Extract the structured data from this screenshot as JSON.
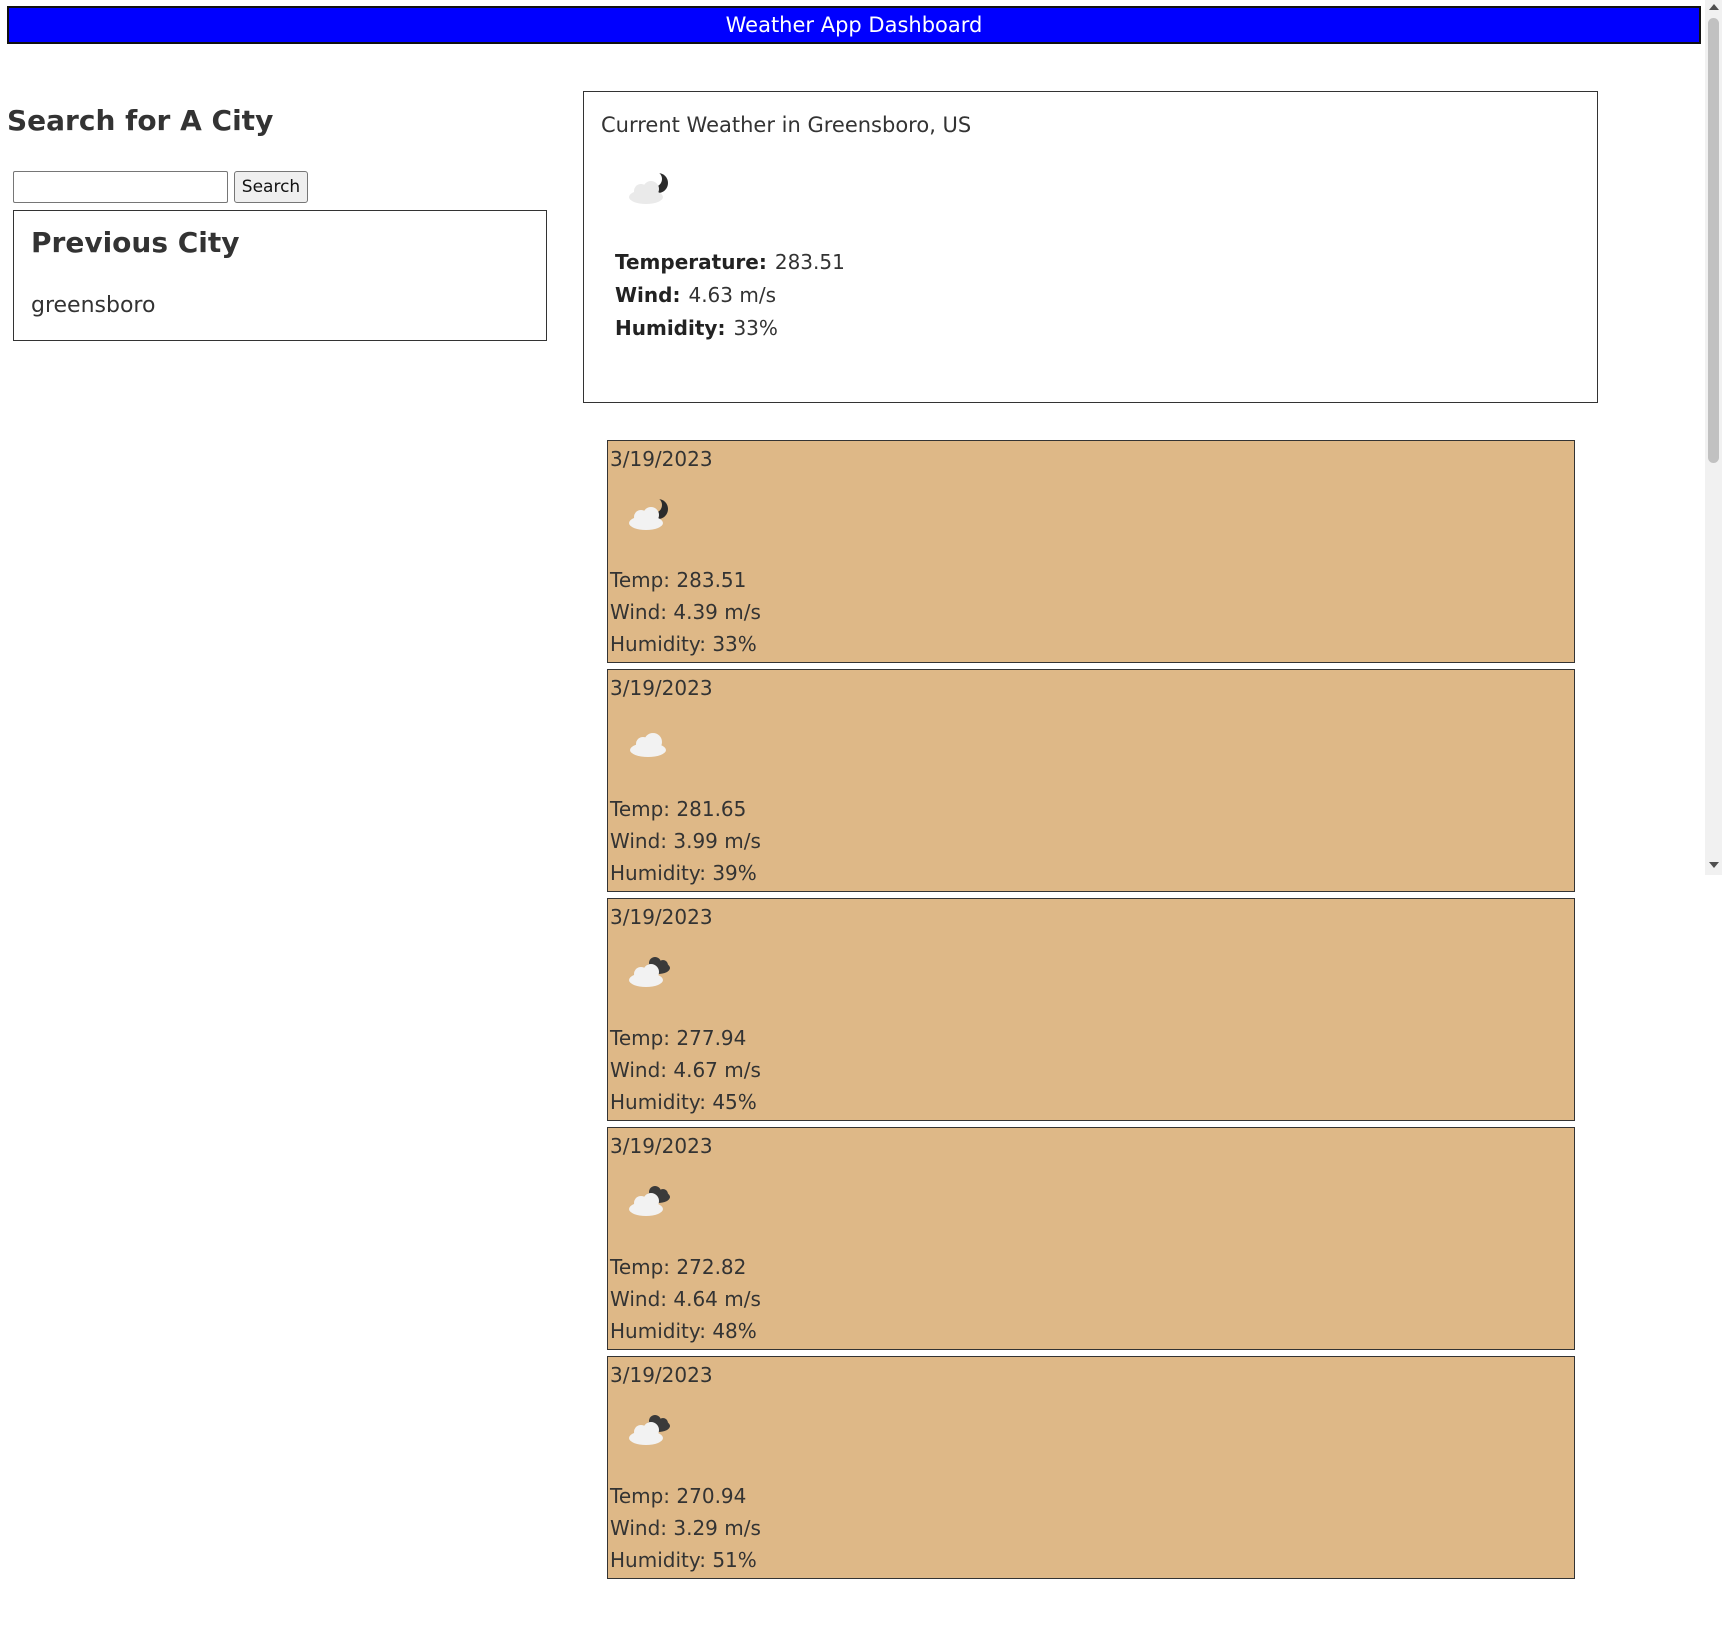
{
  "header": {
    "title": "Weather App Dashboard"
  },
  "search": {
    "title": "Search for A City",
    "placeholder": "",
    "value": "",
    "button_label": "Search"
  },
  "previous": {
    "title": "Previous City",
    "cities": [
      "greensboro"
    ]
  },
  "current": {
    "title": "Current Weather in Greensboro, US",
    "icon": "cloud-night-icon",
    "temperature_label": "Temperature:",
    "temperature": "283.51",
    "wind_label": "Wind:",
    "wind": "4.63 m/s",
    "humidity_label": "Humidity:",
    "humidity": "33%"
  },
  "forecast": [
    {
      "date": "3/19/2023",
      "icon": "cloud-night-icon",
      "temp": "Temp: 283.51",
      "wind": "Wind: 4.39 m/s",
      "humidity": "Humidity: 33%"
    },
    {
      "date": "3/19/2023",
      "icon": "cloud-icon",
      "temp": "Temp: 281.65",
      "wind": "Wind: 3.99 m/s",
      "humidity": "Humidity: 39%"
    },
    {
      "date": "3/19/2023",
      "icon": "broken-clouds-icon",
      "temp": "Temp: 277.94",
      "wind": "Wind: 4.67 m/s",
      "humidity": "Humidity: 45%"
    },
    {
      "date": "3/19/2023",
      "icon": "broken-clouds-icon",
      "temp": "Temp: 272.82",
      "wind": "Wind: 4.64 m/s",
      "humidity": "Humidity: 48%"
    },
    {
      "date": "3/19/2023",
      "icon": "broken-clouds-icon",
      "temp": "Temp: 270.94",
      "wind": "Wind: 3.29 m/s",
      "humidity": "Humidity: 51%"
    }
  ],
  "colors": {
    "header_bg": "#0000ff",
    "forecast_bg": "#deb887"
  }
}
